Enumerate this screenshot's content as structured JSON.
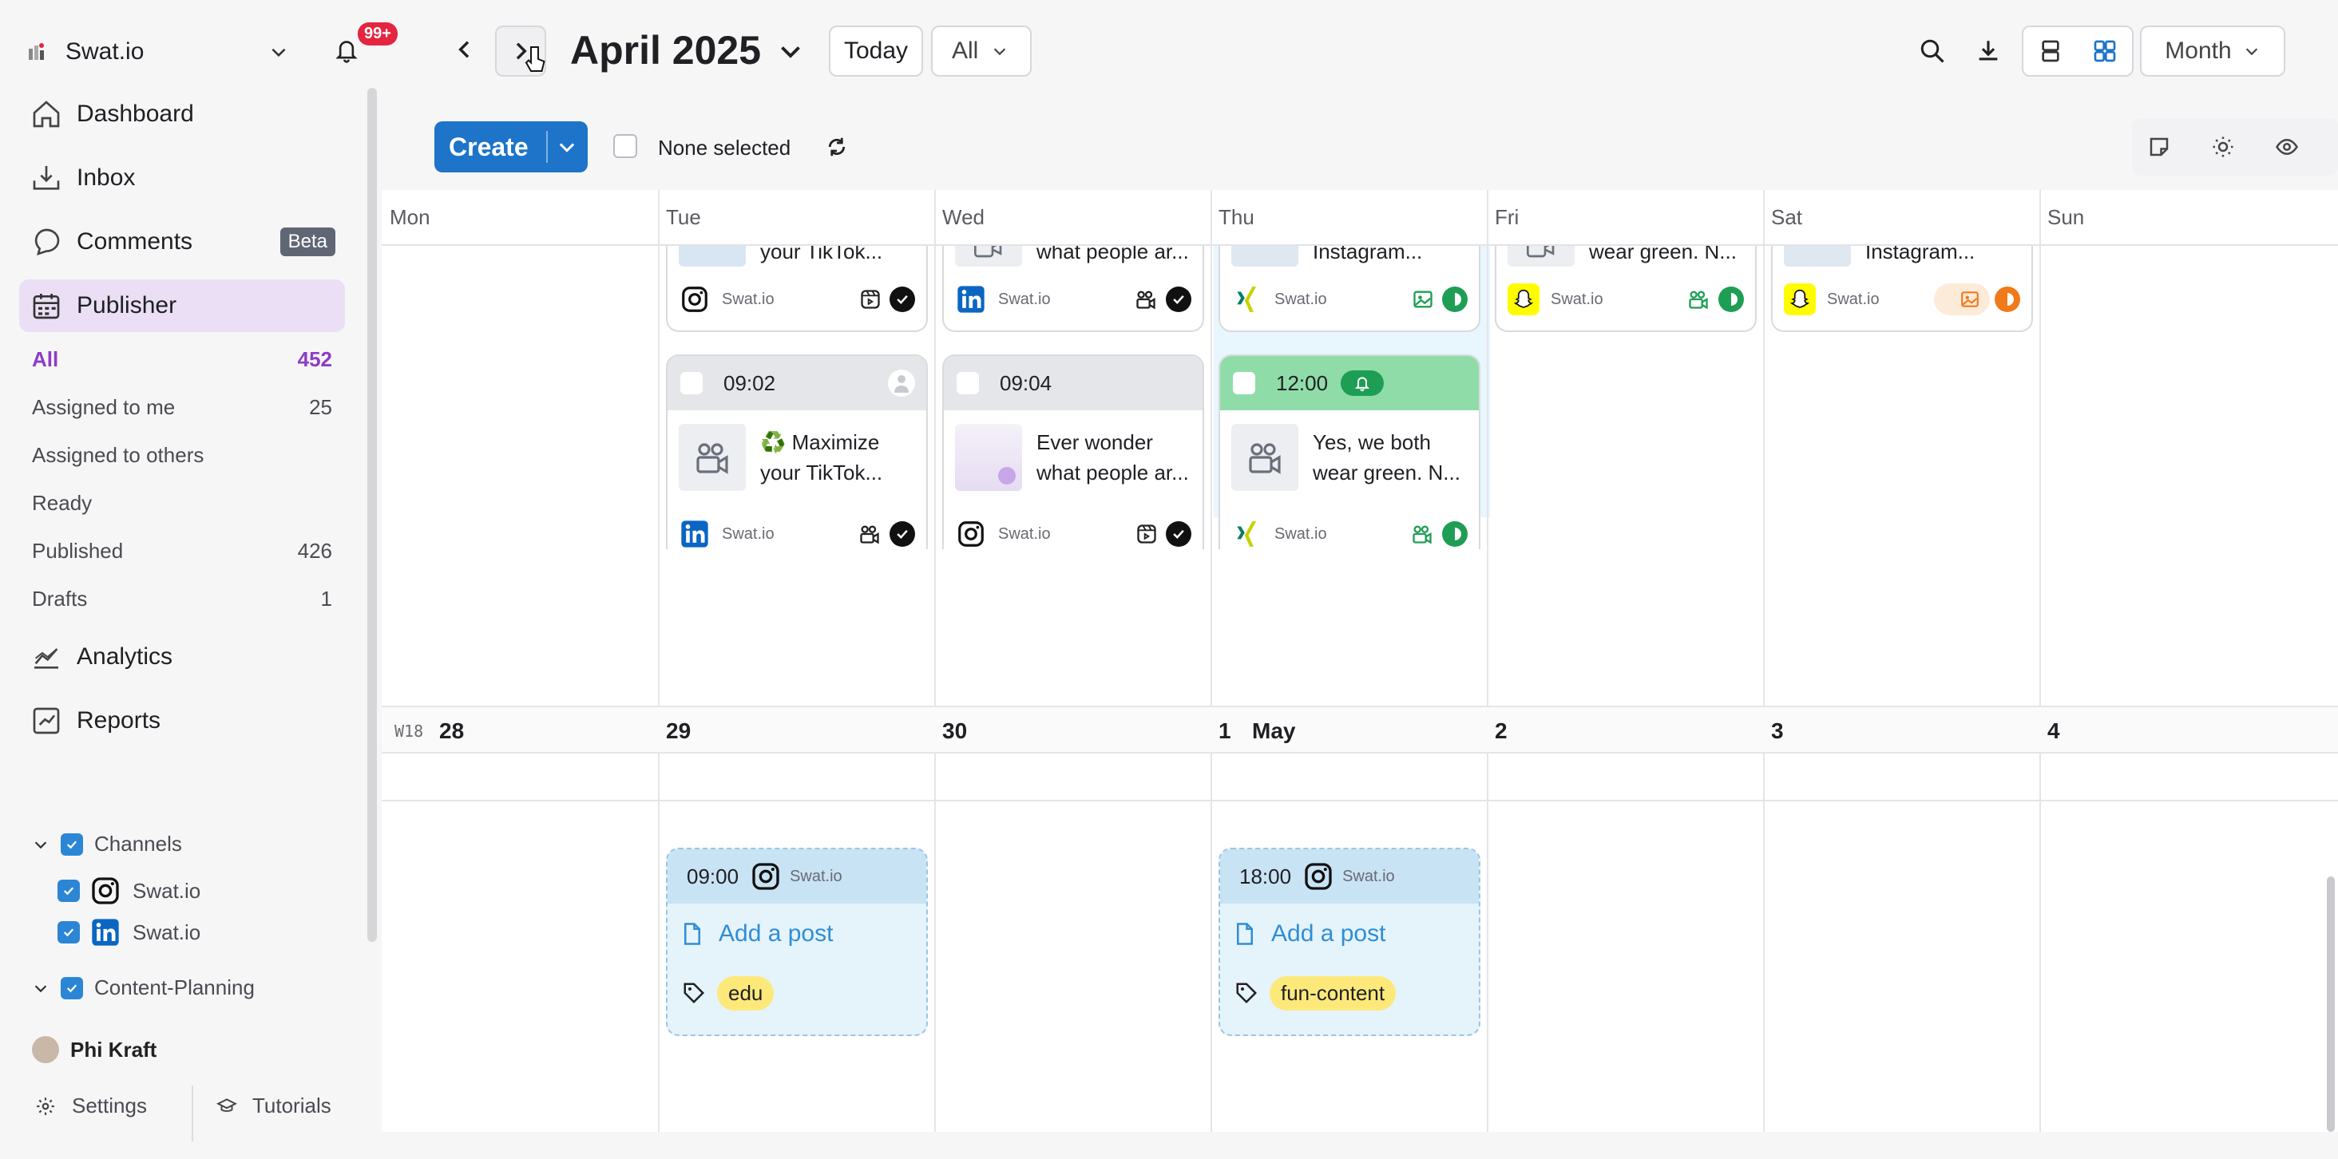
{
  "workspace": {
    "name": "Swat.io",
    "notif_badge": "99+"
  },
  "nav": {
    "dashboard": "Dashboard",
    "inbox": "Inbox",
    "comments": "Comments",
    "comments_badge": "Beta",
    "publisher": "Publisher",
    "analytics": "Analytics",
    "reports": "Reports"
  },
  "publisher_filters": [
    {
      "label": "All",
      "count": "452"
    },
    {
      "label": "Assigned to me",
      "count": "25"
    },
    {
      "label": "Assigned to others",
      "count": ""
    },
    {
      "label": "Ready",
      "count": ""
    },
    {
      "label": "Published",
      "count": "426"
    },
    {
      "label": "Drafts",
      "count": "1"
    }
  ],
  "tree": {
    "channels": "Channels",
    "channel_1": "Swat.io",
    "channel_2": "Swat.io",
    "content_planning": "Content-Planning"
  },
  "user": {
    "name": "Phi Kraft"
  },
  "footer": {
    "settings": "Settings",
    "tutorials": "Tutorials"
  },
  "header": {
    "month_label": "April 2025",
    "today": "Today",
    "filter_all": "All",
    "view": "Month",
    "create": "Create",
    "none_selected": "None selected"
  },
  "days": [
    "Mon",
    "Tue",
    "Wed",
    "Thu",
    "Fri",
    "Sat",
    "Sun"
  ],
  "week2": {
    "label": "W18",
    "dates": [
      "28",
      "29",
      "30",
      "1",
      "2",
      "3",
      "4"
    ],
    "may": "May"
  },
  "row1_cards": [
    {
      "caption": "your TikTok...",
      "channel": "Swat.io"
    },
    {
      "caption": "what people ar...",
      "channel": "Swat.io"
    },
    {
      "caption": "Instagram...",
      "channel": "Swat.io"
    },
    {
      "caption": "wear green. N...",
      "channel": "Swat.io"
    },
    {
      "caption": "Instagram...",
      "channel": "Swat.io"
    }
  ],
  "row2_cards": [
    {
      "time": "09:02",
      "line1": "♻️ Maximize",
      "line2": "your TikTok...",
      "channel": "Swat.io"
    },
    {
      "time": "09:04",
      "line1": "Ever wonder",
      "line2": "what people ar...",
      "channel": "Swat.io"
    },
    {
      "time": "12:00",
      "line1": "Yes, we both",
      "line2": "wear green. N...",
      "channel": "Swat.io"
    }
  ],
  "slots": [
    {
      "time": "09:00",
      "channel": "Swat.io",
      "add": "Add a post",
      "tag": "edu"
    },
    {
      "time": "18:00",
      "channel": "Swat.io",
      "add": "Add a post",
      "tag": "fun-content"
    }
  ],
  "colors": {
    "accent": "#1d74c9",
    "publisher_bg": "#ebdff5",
    "today_col": "#e8f6fd",
    "green": "#1e9e54"
  }
}
